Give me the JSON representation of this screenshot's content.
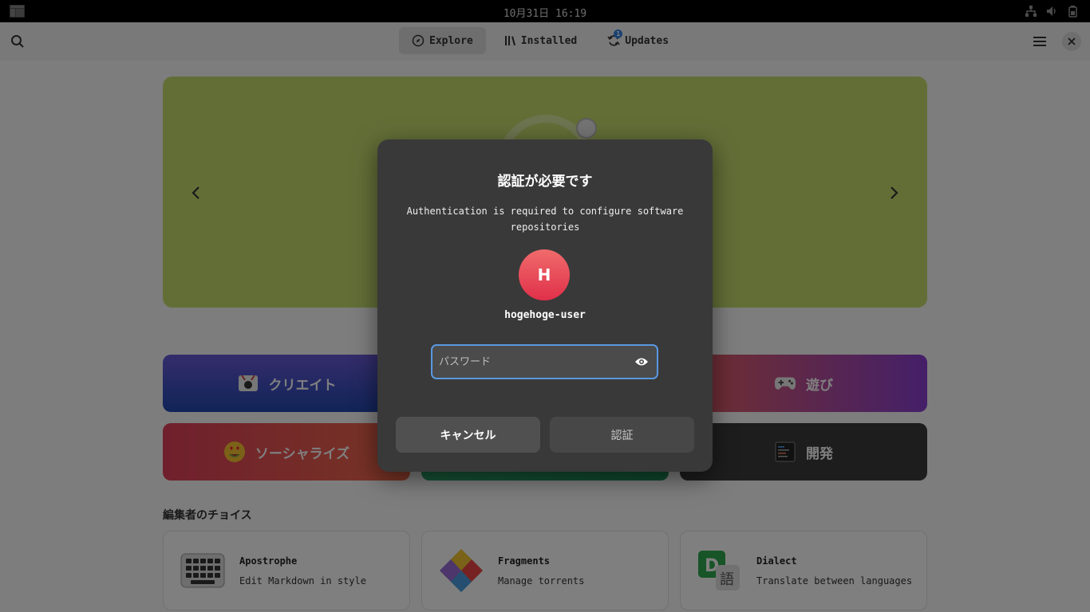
{
  "topbar": {
    "clock": "10月31日 16:19",
    "icons": [
      "activities-icon",
      "network-icon",
      "volume-icon",
      "battery-icon"
    ]
  },
  "header": {
    "tabs": [
      {
        "label": "Explore",
        "icon": "compass-icon",
        "active": true
      },
      {
        "label": "Installed",
        "icon": "library-icon",
        "active": false
      },
      {
        "label": "Updates",
        "icon": "refresh-icon",
        "active": false,
        "badge": "1"
      }
    ]
  },
  "categories": [
    {
      "label": "クリエイト",
      "icon": "create-icon",
      "color": "#2f4fa8"
    },
    {
      "label": "遊び",
      "icon": "gamepad-icon",
      "color": "#8a3fd1"
    },
    {
      "label": "ソーシャライズ",
      "icon": "emoji-icon",
      "color": "#e0405a"
    },
    {
      "label": "",
      "icon": "",
      "color": "#2fa66b"
    },
    {
      "label": "開発",
      "icon": "terminal-icon",
      "color": "#3a3a3a"
    }
  ],
  "editors_choice": {
    "title": "編集者のチョイス",
    "apps": [
      {
        "name": "Apostrophe",
        "desc": "Edit Markdown in style"
      },
      {
        "name": "Fragments",
        "desc": "Manage torrents"
      },
      {
        "name": "Dialect",
        "desc": "Translate between languages"
      }
    ]
  },
  "dialog": {
    "title": "認証が必要です",
    "body": "Authentication is required to configure software repositories",
    "avatar_letter": "H",
    "username": "hogehoge-user",
    "password_placeholder": "パスワード",
    "password_value": "",
    "cancel_label": "キャンセル",
    "authenticate_label": "認証"
  },
  "colors": {
    "accent": "#3584e4",
    "avatar": "#e84a5f",
    "dialog_bg": "#393939"
  }
}
